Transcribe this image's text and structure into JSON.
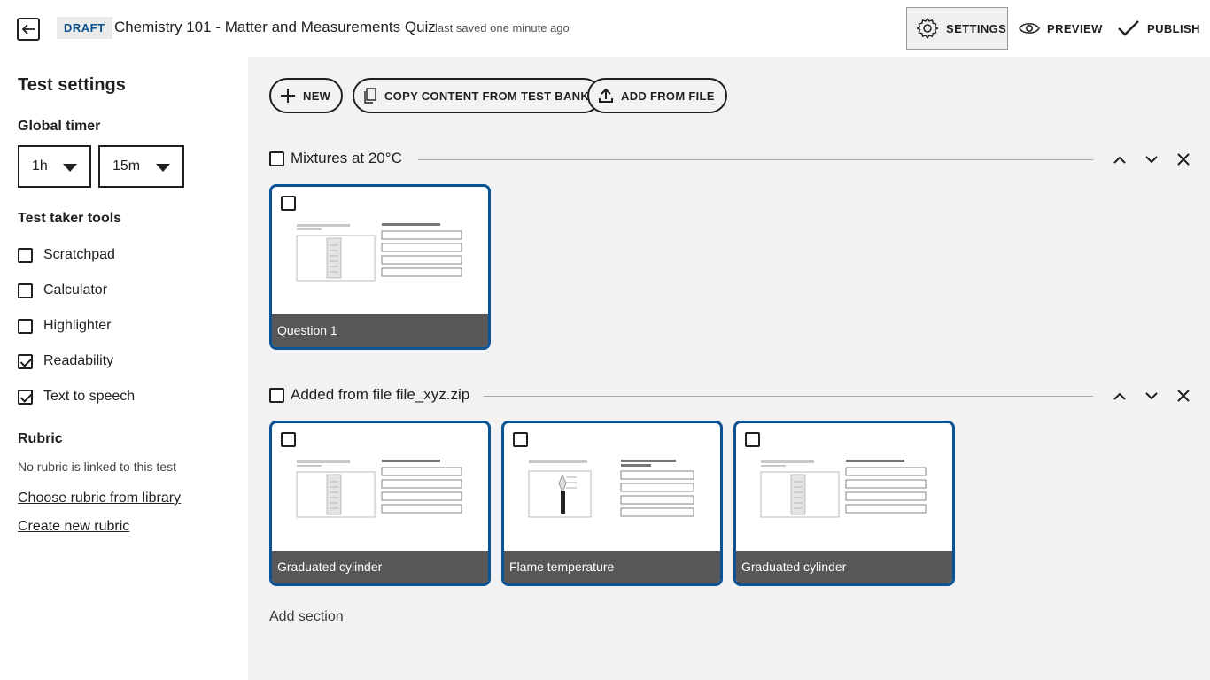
{
  "header": {
    "status_badge": "DRAFT",
    "title": "Chemistry 101 - Matter and Measurements Quiz",
    "saved": "last saved one minute ago",
    "settings_label": "SETTINGS",
    "preview_label": "PREVIEW",
    "publish_label": "PUBLISH"
  },
  "sidebar": {
    "title": "Test settings",
    "timer": {
      "heading": "Global timer",
      "hours": "1h",
      "minutes": "15m"
    },
    "tools": {
      "heading": "Test taker tools",
      "items": [
        {
          "label": "Scratchpad",
          "checked": false
        },
        {
          "label": "Calculator",
          "checked": false
        },
        {
          "label": "Highlighter",
          "checked": false
        },
        {
          "label": "Readability",
          "checked": true
        },
        {
          "label": "Text to speech",
          "checked": true
        }
      ]
    },
    "rubric": {
      "heading": "Rubric",
      "note": "No rubric is linked to this test",
      "choose_link": "Choose rubric from library",
      "create_link": "Create new rubric"
    }
  },
  "main": {
    "actions": {
      "new_label": "NEW",
      "copy_label": "COPY CONTENT FROM TEST BANK",
      "add_file_label": "ADD FROM FILE"
    },
    "sections": [
      {
        "name": "Mixtures at 20°C",
        "cards": [
          {
            "title": "Question 1",
            "thumb": "cylinder"
          }
        ]
      },
      {
        "name": "Added from file file_xyz.zip",
        "cards": [
          {
            "title": "Graduated cylinder",
            "thumb": "cylinder"
          },
          {
            "title": "Flame temperature",
            "thumb": "flame"
          },
          {
            "title": "Graduated cylinder",
            "thumb": "cylinder"
          }
        ]
      }
    ],
    "add_section_label": "Add section"
  },
  "colors": {
    "accent": "#0b5394",
    "badge_text": "#0b4f8c",
    "card_footer": "#575757",
    "main_bg": "#f2f2f2"
  },
  "icons": [
    "back-arrow-icon",
    "gear-icon",
    "eye-icon",
    "check-icon",
    "plus-icon",
    "copy-icon",
    "upload-icon",
    "chevron-up-icon",
    "chevron-down-icon",
    "close-icon"
  ]
}
